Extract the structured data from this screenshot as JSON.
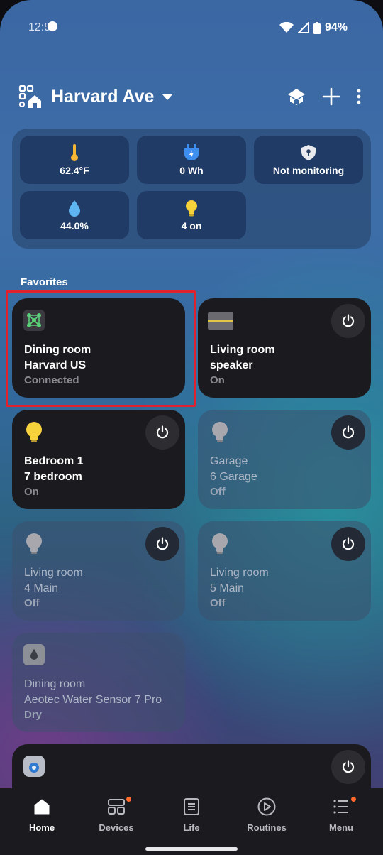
{
  "status_bar": {
    "time": "12:5",
    "battery": "94%"
  },
  "header": {
    "title": "Harvard Ave"
  },
  "summary": [
    {
      "icon": "thermometer-icon",
      "label": "62.4°F"
    },
    {
      "icon": "energy-plug-icon",
      "label": "0 Wh"
    },
    {
      "icon": "security-shield-icon",
      "label": "Not monitoring"
    },
    {
      "icon": "humidity-drop-icon",
      "label": "44.0%"
    },
    {
      "icon": "light-bulb-icon",
      "label": "4 on"
    }
  ],
  "favorites": {
    "title": "Favorites",
    "cards": [
      {
        "room": "Dining room",
        "name": "Harvard US",
        "state": "Connected",
        "icon": "hub-icon"
      },
      {
        "room": "Living room",
        "name": "speaker",
        "state": "On",
        "icon": "speaker-soundbar-icon"
      },
      {
        "room": "Bedroom 1",
        "name": "7 bedroom",
        "state": "On",
        "icon": "light-bulb-on-icon"
      },
      {
        "room": "Garage",
        "name": "6 Garage",
        "state": "Off",
        "icon": "light-bulb-off-icon"
      },
      {
        "room": "Living room",
        "name": "4 Main",
        "state": "Off",
        "icon": "light-bulb-off-icon"
      },
      {
        "room": "Living room",
        "name": "5 Main",
        "state": "Off",
        "icon": "light-bulb-off-icon"
      },
      {
        "room": "Dining room",
        "name": "Aeotec Water Sensor 7 Pro",
        "state": "Dry",
        "icon": "water-sensor-icon"
      }
    ]
  },
  "nav": {
    "items": [
      {
        "label": "Home",
        "active": true
      },
      {
        "label": "Devices",
        "badge": true
      },
      {
        "label": "Life"
      },
      {
        "label": "Routines"
      },
      {
        "label": "Menu",
        "badge": true
      }
    ]
  },
  "colors": {
    "highlight": "#e1212d",
    "badge": "#ff6a2b",
    "bulb_on": "#f6d33a",
    "thermometer": "#f5b731",
    "plug": "#3e8ef0"
  }
}
